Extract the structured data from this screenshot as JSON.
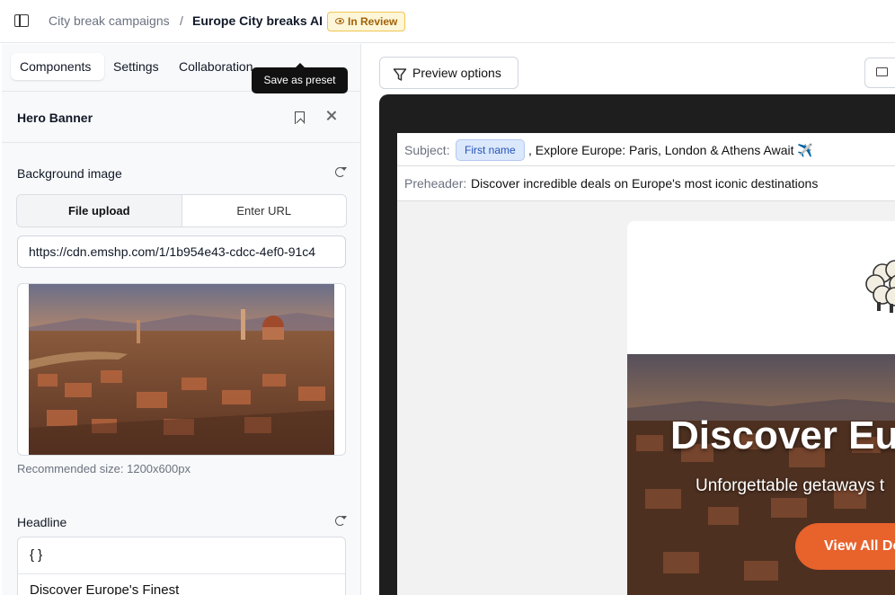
{
  "breadcrumb": {
    "parent": "City break campaigns",
    "separator": "/",
    "current": "Europe City breaks AI",
    "status": "In Review"
  },
  "left_panel": {
    "tabs": [
      {
        "label": "Components",
        "active": true
      },
      {
        "label": "Settings",
        "active": false
      },
      {
        "label": "Collaboration",
        "active": false
      }
    ],
    "tooltip": "Save as preset",
    "component_title": "Hero Banner",
    "background_image": {
      "label": "Background image",
      "options": [
        {
          "label": "File upload",
          "active": true
        },
        {
          "label": "Enter URL",
          "active": false
        }
      ],
      "url_value": "https://cdn.emshp.com/1/1b954e43-cdcc-4ef0-91c4",
      "hint": "Recommended size: 1200x600px"
    },
    "headline": {
      "label": "Headline",
      "brackets": "{ }",
      "value": "Discover Europe's Finest"
    }
  },
  "preview": {
    "options_label": "Preview options",
    "subject_label": "Subject:",
    "subject_chip": "First name",
    "subject_text": ", Explore Europe: Paris, London & Athens Await ✈️",
    "preheader_label": "Preheader:",
    "preheader_text": "Discover incredible deals on Europe's most iconic destinations",
    "hero_title": "Discover Eur",
    "hero_subtitle": "Unforgettable getaways t",
    "cta": "View All De"
  },
  "colors": {
    "status_bg": "#fef6d9",
    "status_text": "#a16207",
    "chip_bg": "#dbe7fb",
    "cta": "#e8622c",
    "preview_frame": "#1e1e1e"
  }
}
